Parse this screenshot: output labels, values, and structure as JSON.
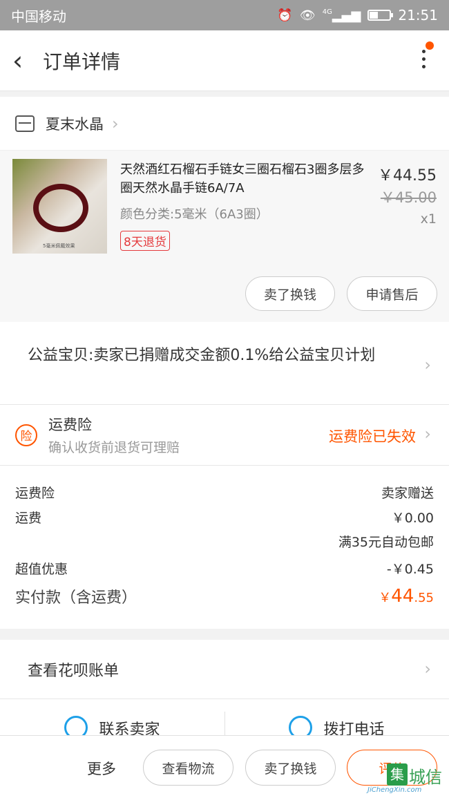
{
  "status_bar": {
    "carrier": "中国移动",
    "signal": "4G",
    "time": "21:51"
  },
  "nav": {
    "back_icon": "chevron-left",
    "title": "订单详情",
    "more_icon": "vertical-ellipsis"
  },
  "shop": {
    "name": "夏末水晶"
  },
  "item": {
    "title": "天然酒红石榴石手链女三圈石榴石3圈多层多圈天然水晶手链6A/7A",
    "spec": "颜色分类:5毫米（6A3圈）",
    "thumb_caption": "5毫米佩戴效果",
    "return_tag": "8天退货",
    "price": "￥44.55",
    "original_price": "￥45.00",
    "quantity": "x1",
    "btn_sell": "卖了换钱",
    "btn_after_sale": "申请售后"
  },
  "charity": {
    "text": "公益宝贝:卖家已捐赠成交金额0.1%给公益宝贝计划"
  },
  "insurance": {
    "title": "运费险",
    "subtitle": "确认收货前退货可理赔",
    "status": "运费险已失效"
  },
  "fees": {
    "insurance_label": "运费险",
    "insurance_value": "卖家赠送",
    "shipping_label": "运费",
    "shipping_value": "￥0.00",
    "shipping_note": "满35元自动包邮",
    "discount_label": "超值优惠",
    "discount_value": "-￥0.45",
    "total_label": "实付款（含运费）",
    "total_currency": "￥",
    "total_main": "44",
    "total_decimal": ".55"
  },
  "huabei": {
    "text": "查看花呗账单"
  },
  "contact": {
    "seller": "联系卖家",
    "phone": "拨打电话"
  },
  "bottom_bar": {
    "more": "更多",
    "logistics": "查看物流",
    "sell": "卖了换钱",
    "rate": "评价"
  },
  "watermark": {
    "logo_char": "集",
    "text": "城信",
    "url": "JiChengXin.com"
  },
  "colors": {
    "accent": "#ff5500",
    "return_red": "#e4393c",
    "contact_blue": "#1ea0e8"
  }
}
